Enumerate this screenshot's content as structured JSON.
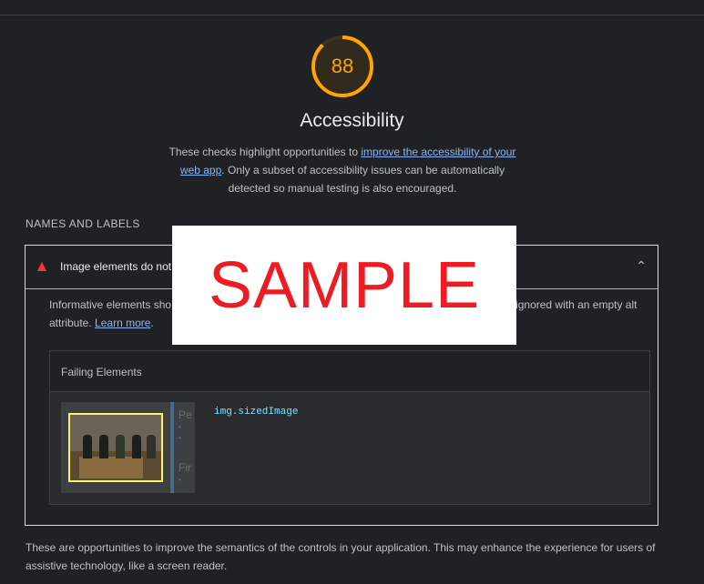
{
  "score": {
    "value": "88",
    "color": "#ffa400"
  },
  "category": {
    "title": "Accessibility",
    "desc_before": "These checks highlight opportunities to ",
    "desc_link": "improve the accessibility of your web app",
    "desc_after": ". Only a subset of accessibility issues can be automatically detected so manual testing is also encouraged."
  },
  "group": {
    "title": "NAMES AND LABELS",
    "footer": "These are opportunities to improve the semantics of the controls in your application. This may enhance the experience for users of assistive technology, like a screen reader."
  },
  "audit": {
    "title": "Image elements do not",
    "status_icon": "fail-triangle-icon",
    "chevron_icon": "chevron-up-icon",
    "desc_start": "Informative elements sho",
    "desc_end": "ignored with an empty alt attribute.",
    "learn_more": "Learn more",
    "learn_more_suffix": ".",
    "details_header": "Failing Elements",
    "selector": "img.sizedImage",
    "thumb_text_1": "Pe",
    "thumb_text_2": "Fir"
  },
  "watermark": {
    "text": "SAMPLE"
  },
  "colors": {
    "background": "#202124",
    "link": "#8ab4f8",
    "fail": "#ff3333",
    "score": "#ffa400"
  }
}
